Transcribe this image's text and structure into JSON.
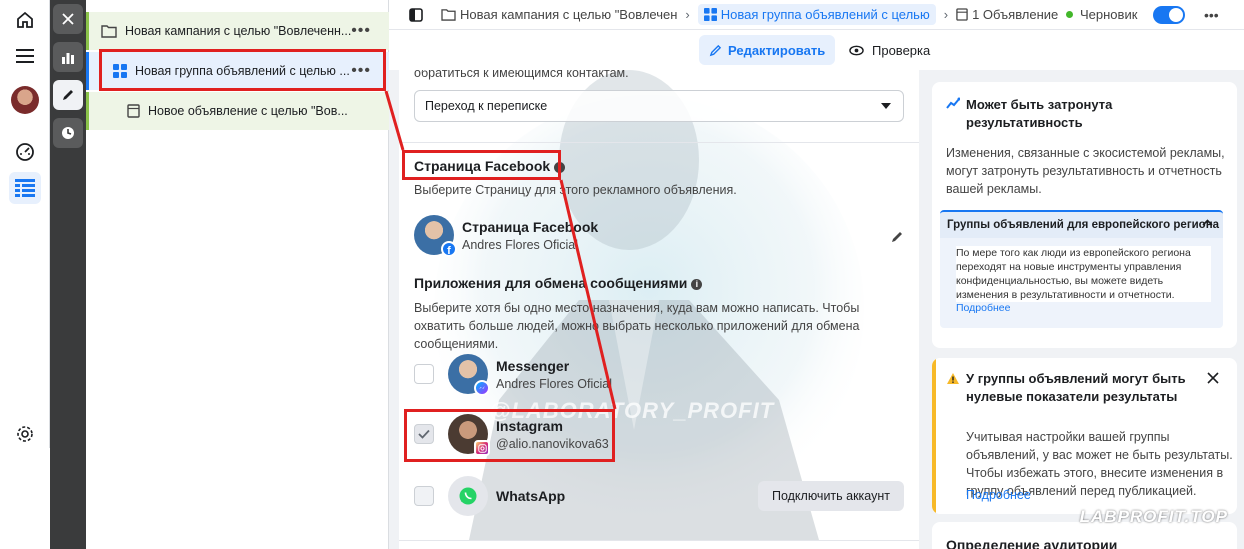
{
  "tree": {
    "campaign": "Новая кампания с целью \"Вовлеченн...",
    "adset": "Новая группа объявлений с целью ...",
    "ad": "Новое объявление с целью \"Вов...",
    "more": "•••"
  },
  "topbar": {
    "crumb_campaign": "Новая кампания с целью \"Вовлечен",
    "crumb_adset": "Новая группа объявлений с целью",
    "crumb_ad": "1 Объявление",
    "status": "Черновик",
    "more": "•••"
  },
  "tabs": {
    "edit": "Редактировать",
    "review": "Проверка"
  },
  "main": {
    "top_clip_text": "обратиться к имеющимся контактам.",
    "destination_select": "Переход к переписке",
    "fb_page_heading": "Страница Facebook",
    "fb_page_help": "Выберите Страницу для этого рекламного объявления.",
    "page_name_label": "Страница Facebook",
    "page_owner": "Andres Flores Oficial",
    "apps_heading": "Приложения для обмена сообщениями",
    "apps_help": "Выберите хотя бы одно место назначения, куда вам можно написать. Чтобы охватить больше людей, можно выбрать несколько приложений для обмена сообщениями.",
    "apps": [
      {
        "name": "Messenger",
        "account": "Andres Flores Oficial",
        "checked": false
      },
      {
        "name": "Instagram",
        "account": "@alio.nanovikova63",
        "checked": true
      },
      {
        "name": "WhatsApp",
        "account": "",
        "checked": false,
        "action": "Подключить аккаунт"
      }
    ],
    "watermark_center": "@LABORATORY_PROFIT"
  },
  "right": {
    "perf_title": "Может быть затронута результативность",
    "perf_body": "Изменения, связанные с экосистемой рекламы, могут затронуть результативность и отчетность вашей рекламы.",
    "eu_title": "Группы объявлений для европейского региона",
    "eu_body": "По мере того как люди из европейского региона переходят на новые инструменты управления конфиденциальностью, вы можете видеть изменения в результативности и отчетности.",
    "eu_link": "Подробнее",
    "warn_title": "У группы объявлений могут быть нулевые показатели результаты",
    "warn_body": "Учитывая настройки вашей группы объявлений, у вас может не быть результаты. Чтобы избежать этого, внесите изменения в группу объявлений перед публикацией.",
    "warn_link": "Подробнее",
    "audience_title": "Определение аудитории"
  },
  "watermark": "LABPROFIT.TOP",
  "colors": {
    "accent": "#1877f2",
    "highlight": "#e02020",
    "warning": "#f7b928",
    "draft": "#42b72a"
  }
}
